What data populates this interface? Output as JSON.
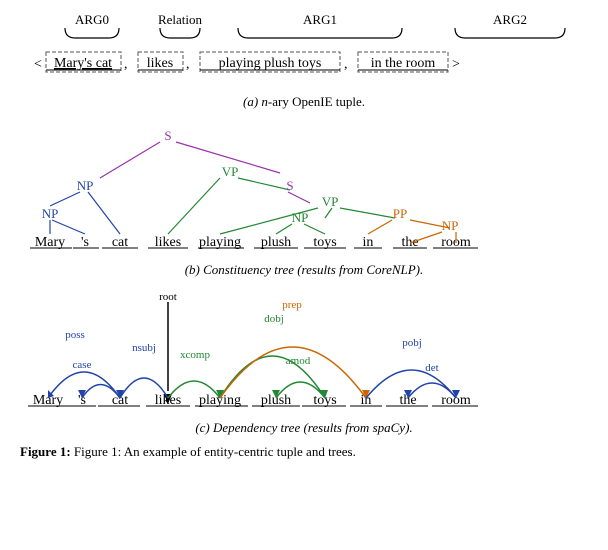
{
  "title": "Figure 1",
  "sections": {
    "a": {
      "caption": "(a) n-ary OpenIE tuple.",
      "labels": [
        "ARG0",
        "Relation",
        "ARG1",
        "ARG2"
      ],
      "tuple": "< Mary's cat , likes , playing plush toys , in the room >"
    },
    "b": {
      "caption": "(b) Constituency tree (results from CoreNLP)."
    },
    "c": {
      "caption": "(c) Dependency tree (results from spaCy)."
    }
  },
  "figure_caption": "Figure 1: An example of entity-centric tuple and trees."
}
